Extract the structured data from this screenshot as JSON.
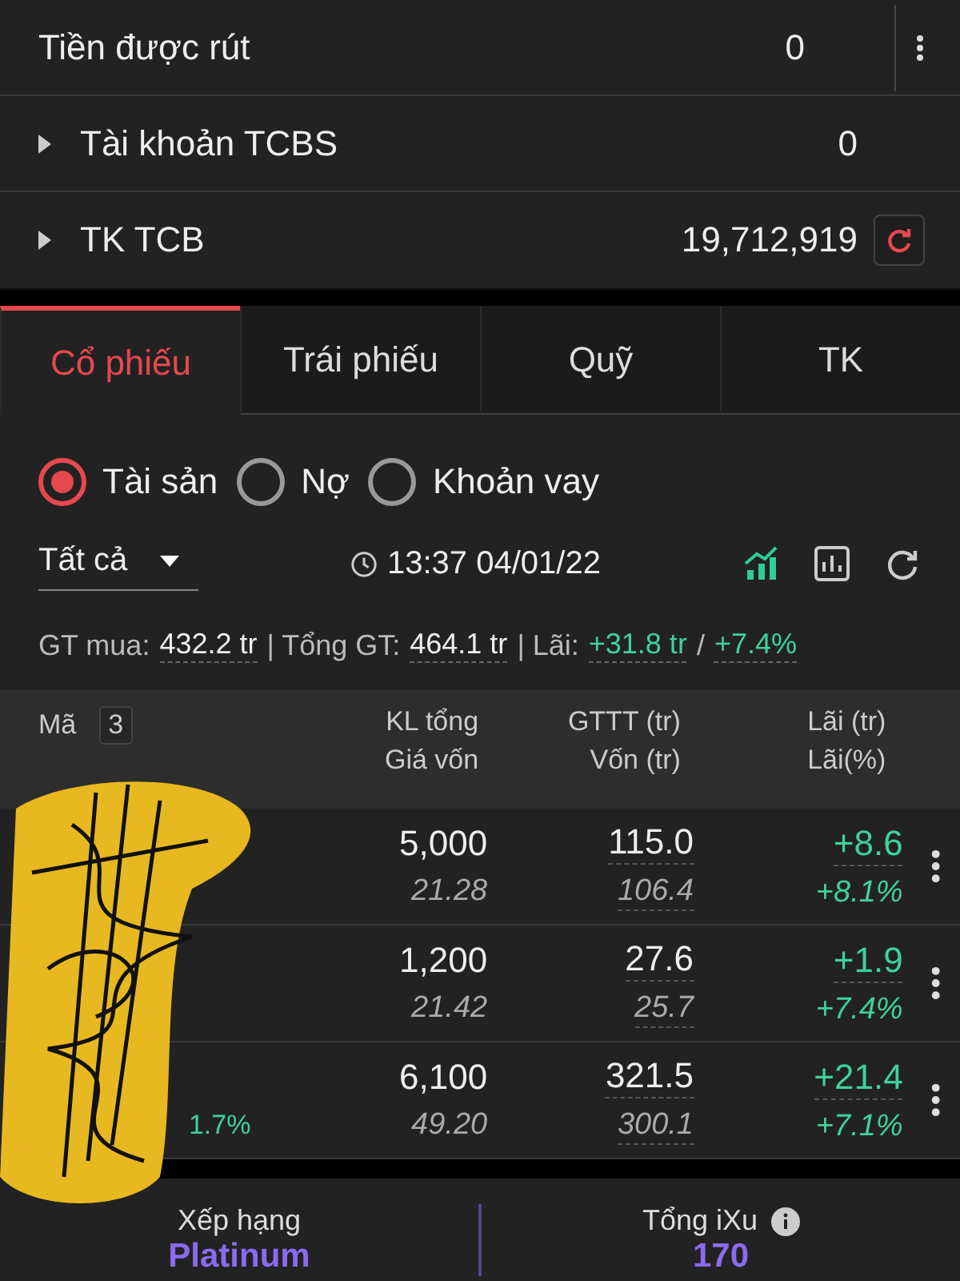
{
  "balances": [
    {
      "label": "Tiền được rút",
      "value": "0",
      "expandable": false,
      "refresh": false,
      "menu": true
    },
    {
      "label": "Tài khoản TCBS",
      "value": "0",
      "expandable": true,
      "refresh": false,
      "menu": false
    },
    {
      "label": "TK TCB",
      "value": "19,712,919",
      "expandable": true,
      "refresh": true,
      "menu": false
    }
  ],
  "tabs": [
    {
      "label": "Cổ phiếu",
      "selected": true
    },
    {
      "label": "Trái phiếu",
      "selected": false
    },
    {
      "label": "Quỹ",
      "selected": false
    },
    {
      "label": "TK",
      "selected": false
    }
  ],
  "radios": [
    {
      "label": "Tài sản",
      "selected": true
    },
    {
      "label": "Nợ",
      "selected": false
    },
    {
      "label": "Khoản vay",
      "selected": false
    }
  ],
  "filter": {
    "value": "Tất cả",
    "time": "13:37 04/01/22"
  },
  "summary": [
    {
      "label": "GT mua:",
      "value": "432.2 tr",
      "kind": "plain"
    },
    {
      "label": "| Tổng GT:",
      "value": "464.1 tr",
      "kind": "plain"
    },
    {
      "label": "| Lãi:",
      "value": "+31.8 tr",
      "kind": "gain"
    },
    {
      "label": "/",
      "value": "+7.4%",
      "kind": "gain"
    }
  ],
  "table": {
    "code_header": "Mã",
    "count": "3",
    "columns": [
      [
        "KL tổng",
        "Giá vốn"
      ],
      [
        "GTTT (tr)",
        "Vốn (tr)"
      ],
      [
        "Lãi (tr)",
        "Lãi(%)"
      ]
    ],
    "rows": [
      {
        "change": "",
        "qty": "5,000",
        "cost": "21.28",
        "value": "115.0",
        "capital": "106.4",
        "profit": "+8.6",
        "profit_pct": "+8.1%"
      },
      {
        "change": "",
        "qty": "1,200",
        "cost": "21.42",
        "value": "27.6",
        "capital": "25.7",
        "profit": "+1.9",
        "profit_pct": "+7.4%"
      },
      {
        "change": "1.7%",
        "qty": "6,100",
        "cost": "49.20",
        "value": "321.5",
        "capital": "300.1",
        "profit": "+21.4",
        "profit_pct": "+7.1%"
      }
    ]
  },
  "stats": [
    {
      "label": "Xếp hạng",
      "value": "Platinum",
      "info": false
    },
    {
      "label": "Tổng iXu",
      "value": "170",
      "info": true
    }
  ]
}
